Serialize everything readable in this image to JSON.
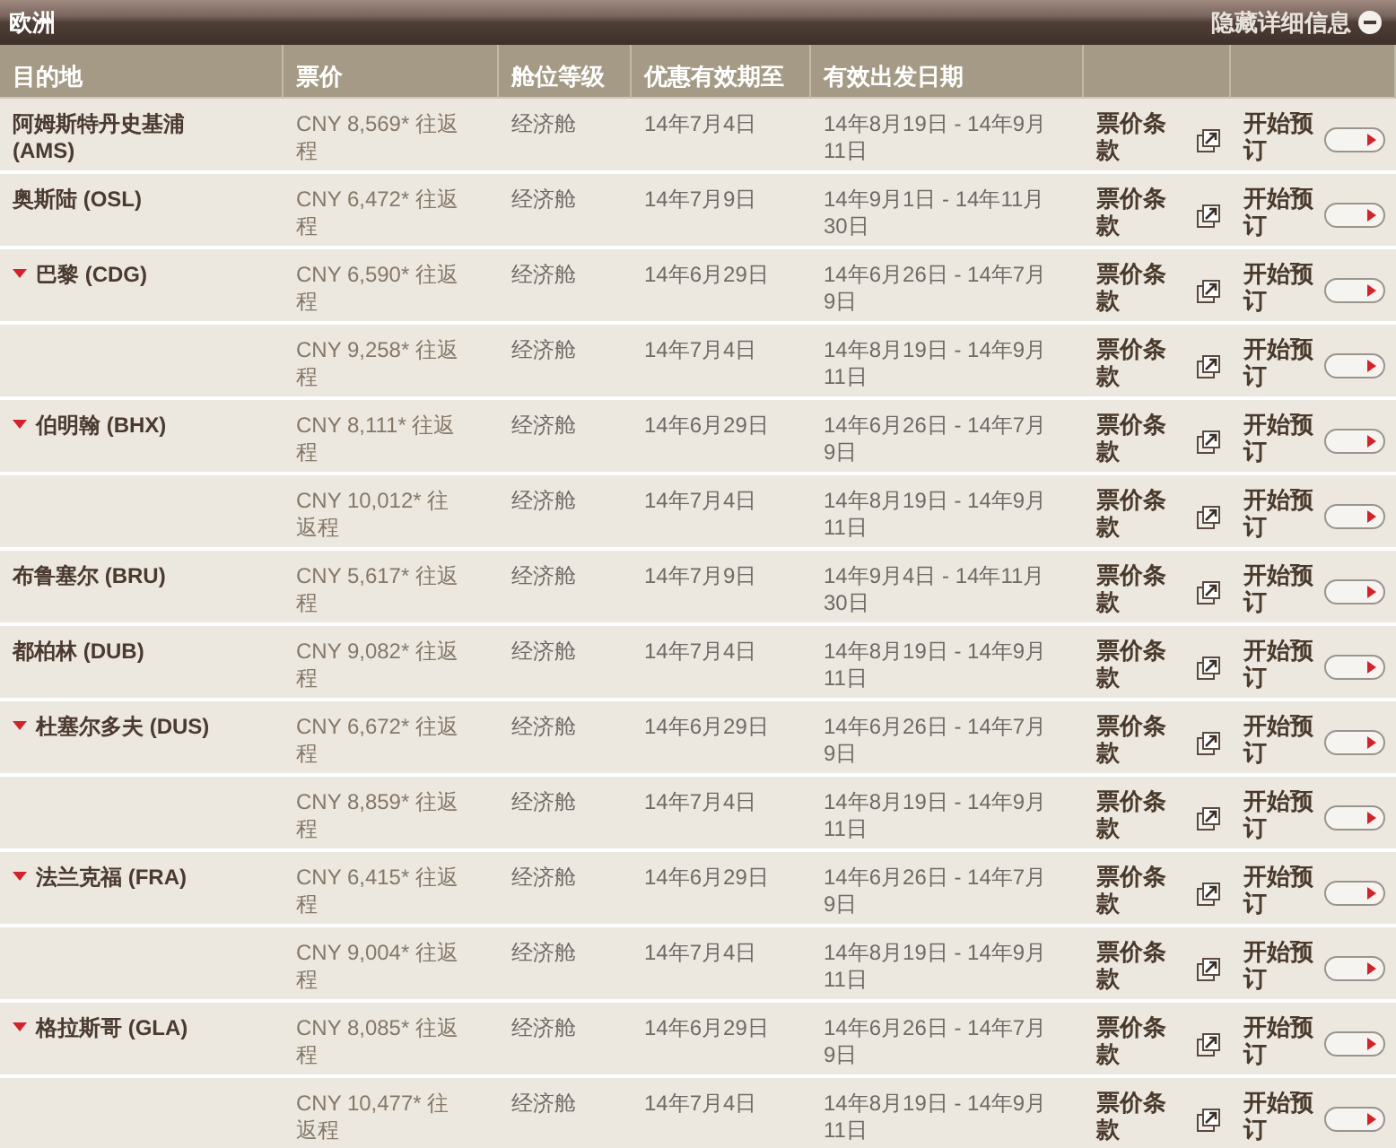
{
  "header": {
    "title": "欧洲",
    "toggle": "隐藏详细信息"
  },
  "columns": [
    "目的地",
    "票价",
    "舱位等级",
    "优惠有效期至",
    "有效出发日期"
  ],
  "rows": [
    {
      "kind": "single",
      "destination": "阿姆斯特丹史基浦 (AMS)",
      "price": "CNY 8,569* 往返程",
      "cabin": "经济舱",
      "valid_until": "14年7月4日",
      "travel_dates": "14年8月19日 - 14年9月11日",
      "terms": "票价条款",
      "book": "开始预订"
    },
    {
      "kind": "single",
      "destination": "奥斯陆 (OSL)",
      "price": "CNY 6,472* 往返程",
      "cabin": "经济舱",
      "valid_until": "14年7月9日",
      "travel_dates": "14年9月1日 - 14年11月30日",
      "terms": "票价条款",
      "book": "开始预订"
    },
    {
      "kind": "group",
      "destination": "巴黎 (CDG)",
      "price": "CNY 6,590* 往返程",
      "cabin": "经济舱",
      "valid_until": "14年6月29日",
      "travel_dates": "14年6月26日 - 14年7月9日",
      "terms": "票价条款",
      "book": "开始预订"
    },
    {
      "kind": "sub",
      "price": "CNY 9,258* 往返程",
      "cabin": "经济舱",
      "valid_until": "14年7月4日",
      "travel_dates": "14年8月19日 - 14年9月11日",
      "terms": "票价条款",
      "book": "开始预订"
    },
    {
      "kind": "group",
      "destination": "伯明翰 (BHX)",
      "price": "CNY 8,111* 往返程",
      "cabin": "经济舱",
      "valid_until": "14年6月29日",
      "travel_dates": "14年6月26日 - 14年7月9日",
      "terms": "票价条款",
      "book": "开始预订"
    },
    {
      "kind": "sub",
      "price": "CNY 10,012* 往返程",
      "cabin": "经济舱",
      "valid_until": "14年7月4日",
      "travel_dates": "14年8月19日 - 14年9月11日",
      "terms": "票价条款",
      "book": "开始预订"
    },
    {
      "kind": "single",
      "destination": "布鲁塞尔 (BRU)",
      "price": "CNY 5,617* 往返程",
      "cabin": "经济舱",
      "valid_until": "14年7月9日",
      "travel_dates": "14年9月4日 - 14年11月30日",
      "terms": "票价条款",
      "book": "开始预订"
    },
    {
      "kind": "single",
      "destination": "都柏林 (DUB)",
      "price": "CNY 9,082* 往返程",
      "cabin": "经济舱",
      "valid_until": "14年7月4日",
      "travel_dates": "14年8月19日 - 14年9月11日",
      "terms": "票价条款",
      "book": "开始预订"
    },
    {
      "kind": "group",
      "destination": "杜塞尔多夫 (DUS)",
      "price": "CNY 6,672* 往返程",
      "cabin": "经济舱",
      "valid_until": "14年6月29日",
      "travel_dates": "14年6月26日 - 14年7月9日",
      "terms": "票价条款",
      "book": "开始预订"
    },
    {
      "kind": "sub",
      "price": "CNY 8,859* 往返程",
      "cabin": "经济舱",
      "valid_until": "14年7月4日",
      "travel_dates": "14年8月19日 - 14年9月11日",
      "terms": "票价条款",
      "book": "开始预订"
    },
    {
      "kind": "group",
      "destination": "法兰克福 (FRA)",
      "price": "CNY 6,415* 往返程",
      "cabin": "经济舱",
      "valid_until": "14年6月29日",
      "travel_dates": "14年6月26日 - 14年7月9日",
      "terms": "票价条款",
      "book": "开始预订"
    },
    {
      "kind": "sub",
      "price": "CNY 9,004* 往返程",
      "cabin": "经济舱",
      "valid_until": "14年7月4日",
      "travel_dates": "14年8月19日 - 14年9月11日",
      "terms": "票价条款",
      "book": "开始预订"
    },
    {
      "kind": "group",
      "destination": "格拉斯哥 (GLA)",
      "price": "CNY 8,085* 往返程",
      "cabin": "经济舱",
      "valid_until": "14年6月29日",
      "travel_dates": "14年6月26日 - 14年7月9日",
      "terms": "票价条款",
      "book": "开始预订"
    },
    {
      "kind": "sub",
      "price": "CNY 10,477* 往返程",
      "cabin": "经济舱",
      "valid_until": "14年7月4日",
      "travel_dates": "14年8月19日 - 14年9月11日",
      "terms": "票价条款",
      "book": "开始预订"
    }
  ]
}
